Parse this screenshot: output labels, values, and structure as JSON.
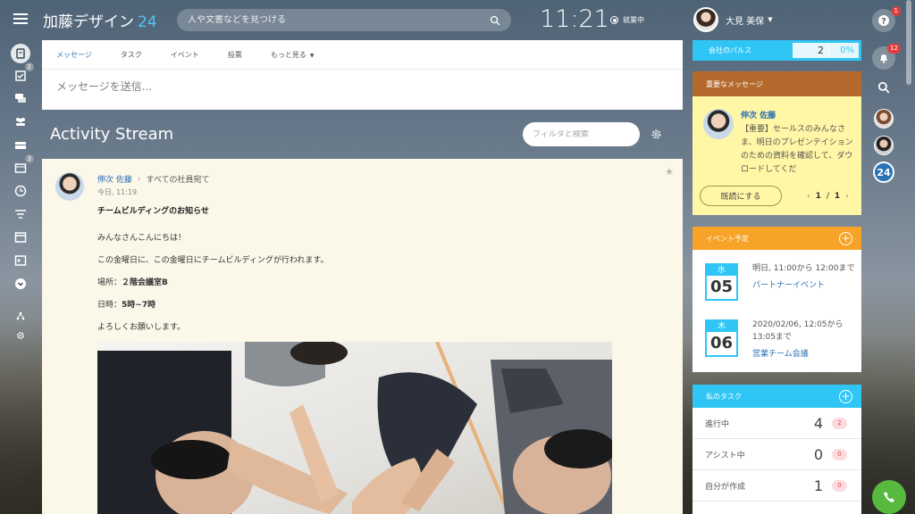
{
  "header": {
    "logo_text": "加藤デザイン",
    "logo_number": "24",
    "search_placeholder": "人や文書などを見つける",
    "clock": "11:21",
    "work_status": "就業中",
    "user_name": "大見 美保"
  },
  "leftnav": {
    "badges": {
      "tasks": "2",
      "calendar": "3"
    }
  },
  "composer": {
    "tabs": [
      {
        "label": "メッセージ"
      },
      {
        "label": "タスク"
      },
      {
        "label": "イベント"
      },
      {
        "label": "投票"
      },
      {
        "label": "もっと見る"
      }
    ],
    "input_placeholder": "メッセージを送信..."
  },
  "stream": {
    "title": "Activity Stream",
    "filter_placeholder": "フィルタと検索"
  },
  "post": {
    "author": "伸次 佐藤",
    "target": "すべての社員宛て",
    "time": "今日, 11:19",
    "title": "チームビルディングのお知らせ",
    "lines": {
      "greeting": "みんなさんこんにちは！",
      "line2": "この金曜日に、この金曜日にチームビルディングが行われます。",
      "place_label": "場所：",
      "place_value": "２階会議室B",
      "time_label": "日時：",
      "time_value": "5時~7時",
      "closing": "よろしくお願いします。"
    }
  },
  "pulse": {
    "label": "会社のパルス",
    "value": "2",
    "percent": "0%"
  },
  "important": {
    "header": "重要なメッセージ",
    "author": "伸次 佐藤",
    "text": "【重要】セールスのみんなさま、明日のプレゼンテイションのための資料を確認して、ダウロードしてくだ",
    "button": "既読にする",
    "pager_current": "1",
    "pager_sep": "/",
    "pager_total": "1"
  },
  "events": {
    "header": "イベント予定",
    "items": [
      {
        "day": "水",
        "date": "05",
        "when": "明日, 11:00から 12:00まで",
        "title": "パートナーイベント"
      },
      {
        "day": "木",
        "date": "06",
        "when": "2020/02/06, 12:05から 13:05まで",
        "title": "営業チーム会議"
      }
    ]
  },
  "tasks": {
    "header": "私のタスク",
    "rows": [
      {
        "label": "進行中",
        "count": "4",
        "badge": "2"
      },
      {
        "label": "アシスト中",
        "count": "0",
        "badge": "0"
      },
      {
        "label": "自分が作成",
        "count": "1",
        "badge": "0"
      }
    ]
  },
  "rightstrip": {
    "help_badge": "1",
    "notif_badge": "12",
    "b24": "24"
  },
  "colors": {
    "accent": "#2fc6f6",
    "important_header": "#b46a2d",
    "events_header": "#f7a328",
    "link": "#2b6fb4"
  }
}
